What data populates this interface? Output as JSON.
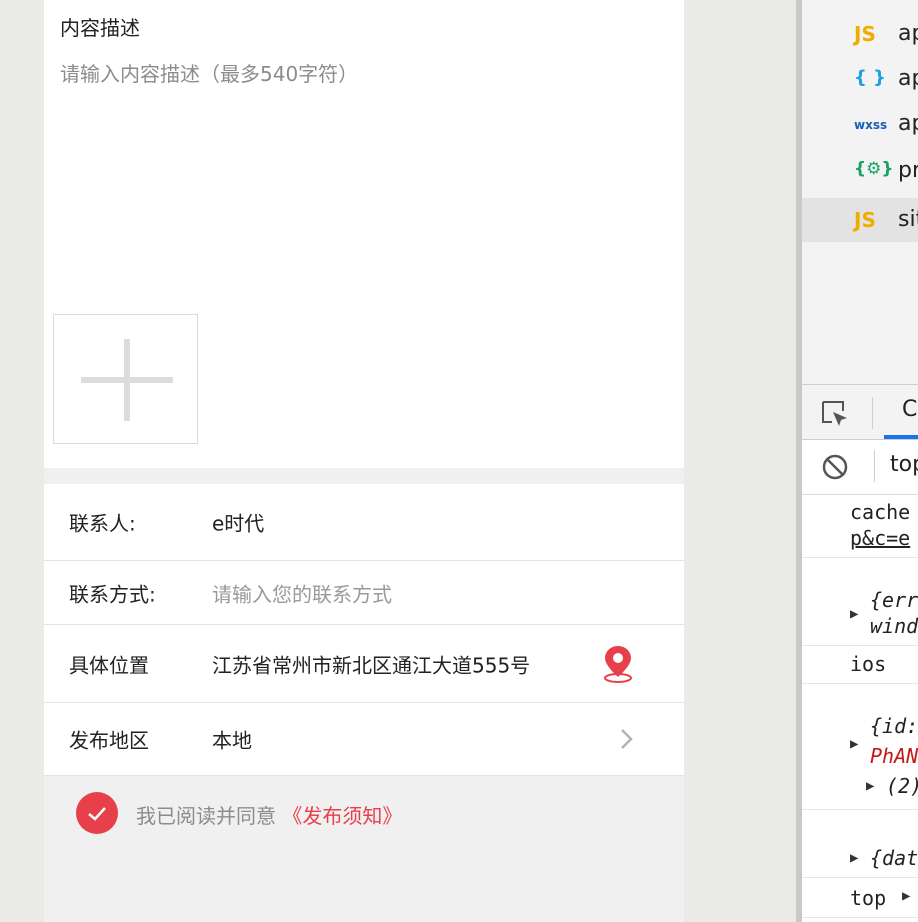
{
  "form": {
    "description": {
      "label": "内容描述",
      "placeholder": "请输入内容描述（最多540字符）"
    },
    "contact_person": {
      "label": "联系人:",
      "value": "e时代"
    },
    "contact_method": {
      "label": "联系方式:",
      "placeholder": "请输入您的联系方式"
    },
    "location": {
      "label": "具体位置",
      "value": "江苏省常州市新北区通江大道555号"
    },
    "region": {
      "label": "发布地区",
      "value": "本地"
    },
    "agreement": {
      "text": "我已阅读并同意",
      "link": "《发布须知》",
      "checked": true
    }
  },
  "devtools": {
    "files": [
      {
        "icon": "JS",
        "icon_color": "#f0ad00",
        "name": "ap"
      },
      {
        "icon": "{ }",
        "icon_color": "#1ba1e2",
        "name": "ap"
      },
      {
        "icon": "wxss",
        "icon_color": "#1a5fb4",
        "name": "ap"
      },
      {
        "icon": "{⚙}",
        "icon_color": "#1aa260",
        "name": "pr"
      },
      {
        "icon": "JS",
        "icon_color": "#f0ad00",
        "name": "sit",
        "selected": true
      }
    ],
    "tab": "C",
    "context": "top",
    "console": {
      "line1a": "cache",
      "line1b": "p&c=e",
      "line2a": "{err",
      "line2b": "wind",
      "line3": "ios",
      "line4a": "{id:",
      "line4b": "PhAN",
      "line4c": "(2)",
      "line5": "{dat",
      "line6": "top"
    }
  },
  "colors": {
    "accent_red": "#e8404a",
    "devtools_blue": "#1a73e8"
  }
}
